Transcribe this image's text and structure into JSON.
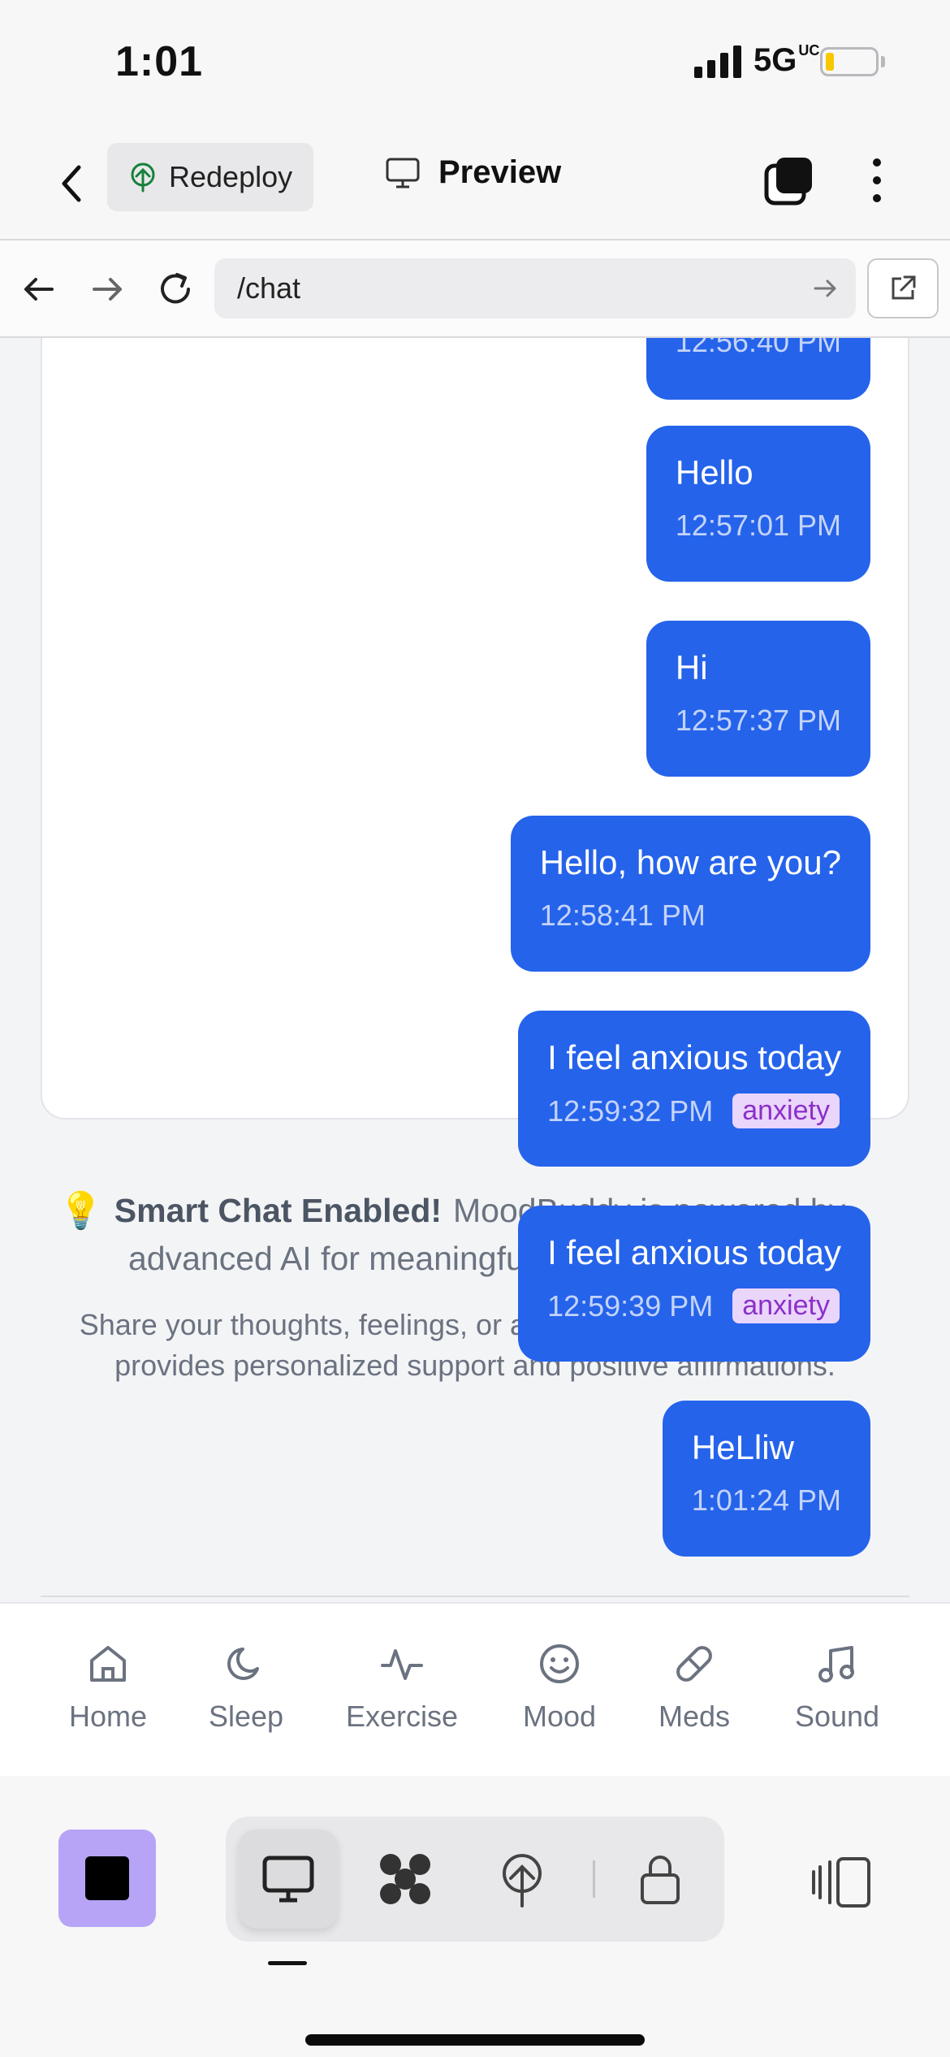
{
  "status": {
    "time": "1:01",
    "network": "5G",
    "network_suffix": "UC"
  },
  "topbar": {
    "redeploy_label": "Redeploy",
    "preview_label": "Preview"
  },
  "browser": {
    "url": "/chat"
  },
  "chat": {
    "partial_timestamp": "12:56:40 PM",
    "messages": [
      {
        "text": "Hello",
        "time": "12:57:01 PM",
        "tag": ""
      },
      {
        "text": "Hi",
        "time": "12:57:37 PM",
        "tag": ""
      },
      {
        "text": "Hello, how are you?",
        "time": "12:58:41 PM",
        "tag": ""
      },
      {
        "text": "I feel anxious today",
        "time": "12:59:32 PM",
        "tag": "anxiety"
      },
      {
        "text": "I feel anxious today",
        "time": "12:59:39 PM",
        "tag": "anxiety"
      },
      {
        "text": "HeLliw",
        "time": "1:01:24 PM",
        "tag": ""
      }
    ]
  },
  "info": {
    "bold": "Smart Chat Enabled!",
    "line1_rest": "MoodBuddy is powered by",
    "line2": "advanced AI for meaningful conversations.",
    "sub": "Share your thoughts, feelings, or ask questions - MoodBuddy provides personalized support and positive affirmations."
  },
  "bottom_nav": [
    {
      "label": "Home",
      "icon": "home-icon"
    },
    {
      "label": "Sleep",
      "icon": "moon-icon"
    },
    {
      "label": "Exercise",
      "icon": "activity-icon"
    },
    {
      "label": "Mood",
      "icon": "smile-icon"
    },
    {
      "label": "Meds",
      "icon": "pill-icon"
    },
    {
      "label": "Sound",
      "icon": "music-icon"
    }
  ],
  "colors": {
    "bubble": "#2563eb",
    "tag_bg": "#ead5fb",
    "tag_text": "#8b2fc9",
    "stop_bg": "#b7a4f7"
  }
}
